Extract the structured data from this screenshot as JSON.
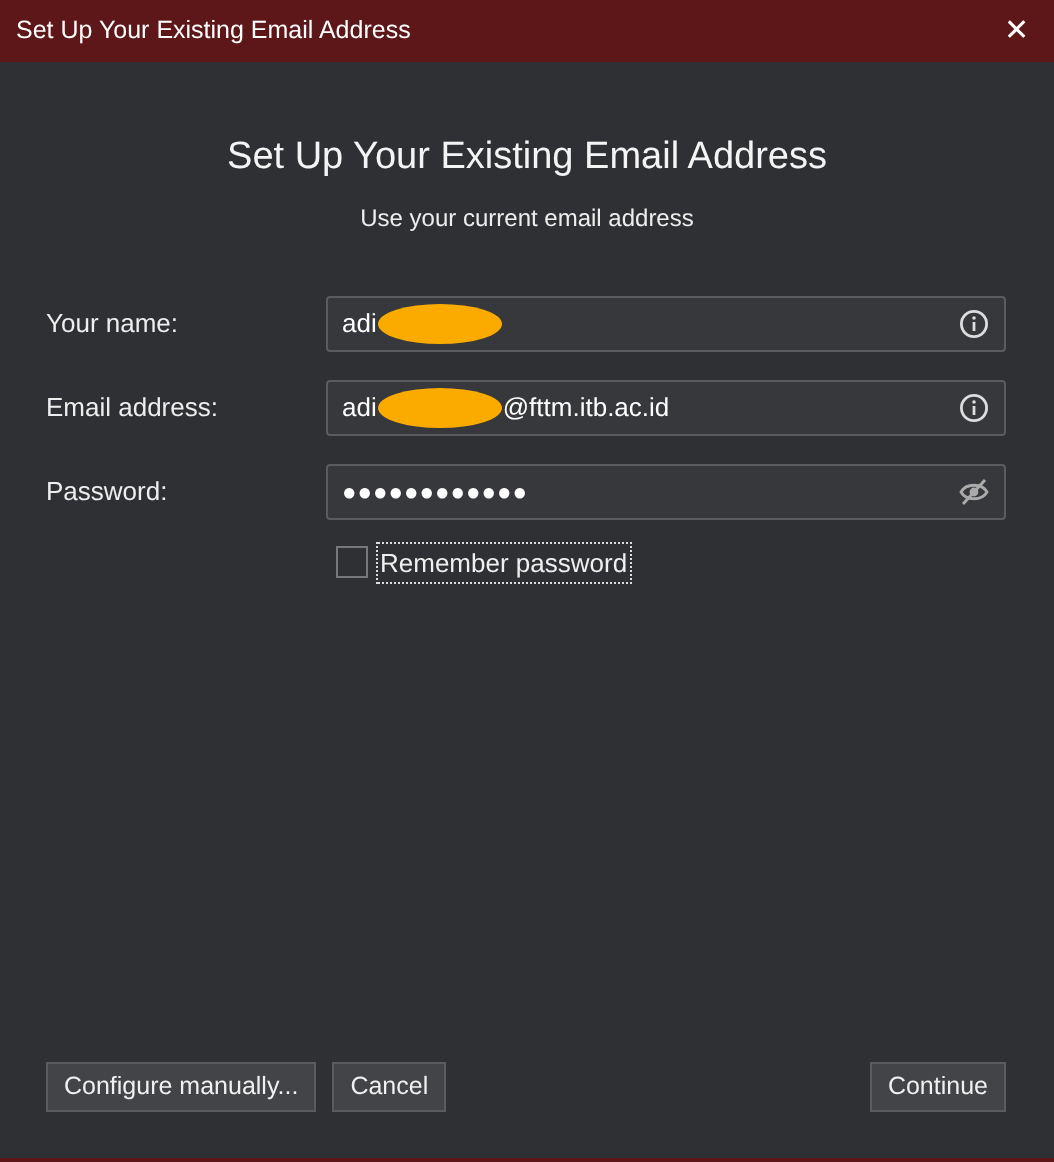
{
  "window": {
    "title": "Set Up Your Existing Email Address",
    "close_glyph": "✕"
  },
  "heading": "Set Up Your Existing Email Address",
  "subheading": "Use your current email address",
  "fields": [
    {
      "label": "Your name:",
      "kind": "text",
      "parts": [
        {
          "kind": "text",
          "text": "adi"
        },
        {
          "kind": "redaction"
        }
      ]
    },
    {
      "label": "Email address:",
      "kind": "text",
      "parts": [
        {
          "kind": "text",
          "text": "adi"
        },
        {
          "kind": "redaction"
        },
        {
          "kind": "text",
          "text": "@fttm.itb.ac.id"
        }
      ]
    },
    {
      "label": "Password:",
      "kind": "password",
      "parts": [
        {
          "kind": "text",
          "text": "●●●●●●●●●●●●"
        }
      ]
    }
  ],
  "remember": {
    "label": "Remember password",
    "checked": false,
    "focused": true
  },
  "buttons_left": [
    "Configure manually...",
    "Cancel"
  ],
  "buttons_right": [
    "Continue"
  ]
}
